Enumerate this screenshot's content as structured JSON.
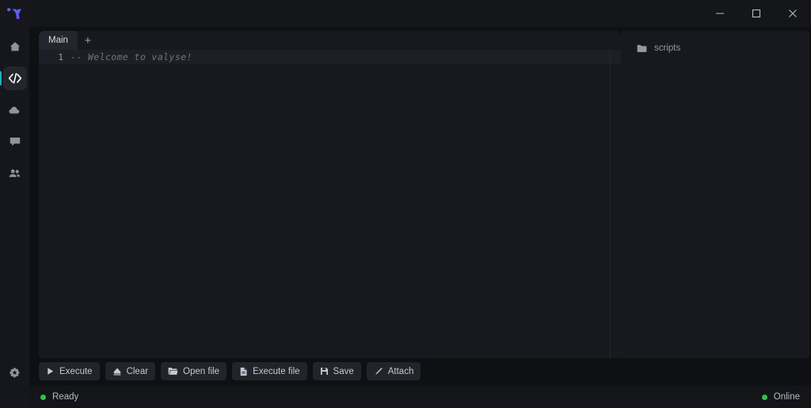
{
  "window": {
    "logo_name": "valyse-logo",
    "controls": [
      {
        "name": "minimize-button",
        "label": "Minimize"
      },
      {
        "name": "maximize-button",
        "label": "Maximize"
      },
      {
        "name": "close-button",
        "label": "Close"
      }
    ]
  },
  "sidebar": {
    "items": [
      {
        "name": "sidebar-item-home",
        "icon": "home-icon",
        "label": "Home",
        "active": false
      },
      {
        "name": "sidebar-item-editor",
        "icon": "code-icon",
        "label": "Editor",
        "active": true
      },
      {
        "name": "sidebar-item-cloud",
        "icon": "cloud-icon",
        "label": "Cloud",
        "active": false
      },
      {
        "name": "sidebar-item-chat",
        "icon": "chat-icon",
        "label": "Chat",
        "active": false
      },
      {
        "name": "sidebar-item-users",
        "icon": "users-icon",
        "label": "Users",
        "active": false
      }
    ],
    "bottom": {
      "name": "sidebar-item-settings",
      "icon": "gear-icon",
      "label": "Settings"
    }
  },
  "editor": {
    "tabs": [
      {
        "label": "Main",
        "active": true
      }
    ],
    "add_tab_label": "+",
    "line_number": "1",
    "code": "-- Welcome to valyse!"
  },
  "files": {
    "items": [
      {
        "icon": "folder-icon",
        "label": "scripts"
      }
    ]
  },
  "toolbar": {
    "buttons": [
      {
        "name": "execute-button",
        "icon": "play-icon",
        "label": "Execute"
      },
      {
        "name": "clear-button",
        "icon": "eraser-icon",
        "label": "Clear"
      },
      {
        "name": "open-file-button",
        "icon": "folder-icon",
        "label": "Open file"
      },
      {
        "name": "execute-file-button",
        "icon": "document-icon",
        "label": "Execute file"
      },
      {
        "name": "save-button",
        "icon": "floppy-icon",
        "label": "Save"
      },
      {
        "name": "attach-button",
        "icon": "pen-icon",
        "label": "Attach"
      }
    ]
  },
  "statusbar": {
    "left_text": "Ready",
    "left_color": "#2fbf4a",
    "right_text": "Online",
    "right_color": "#2fbf4a"
  },
  "colors": {
    "accent": "#17b3c4",
    "window_bg": "#0f1013",
    "panel_bg": "#17191e",
    "sidebar_bg": "#16171c"
  }
}
